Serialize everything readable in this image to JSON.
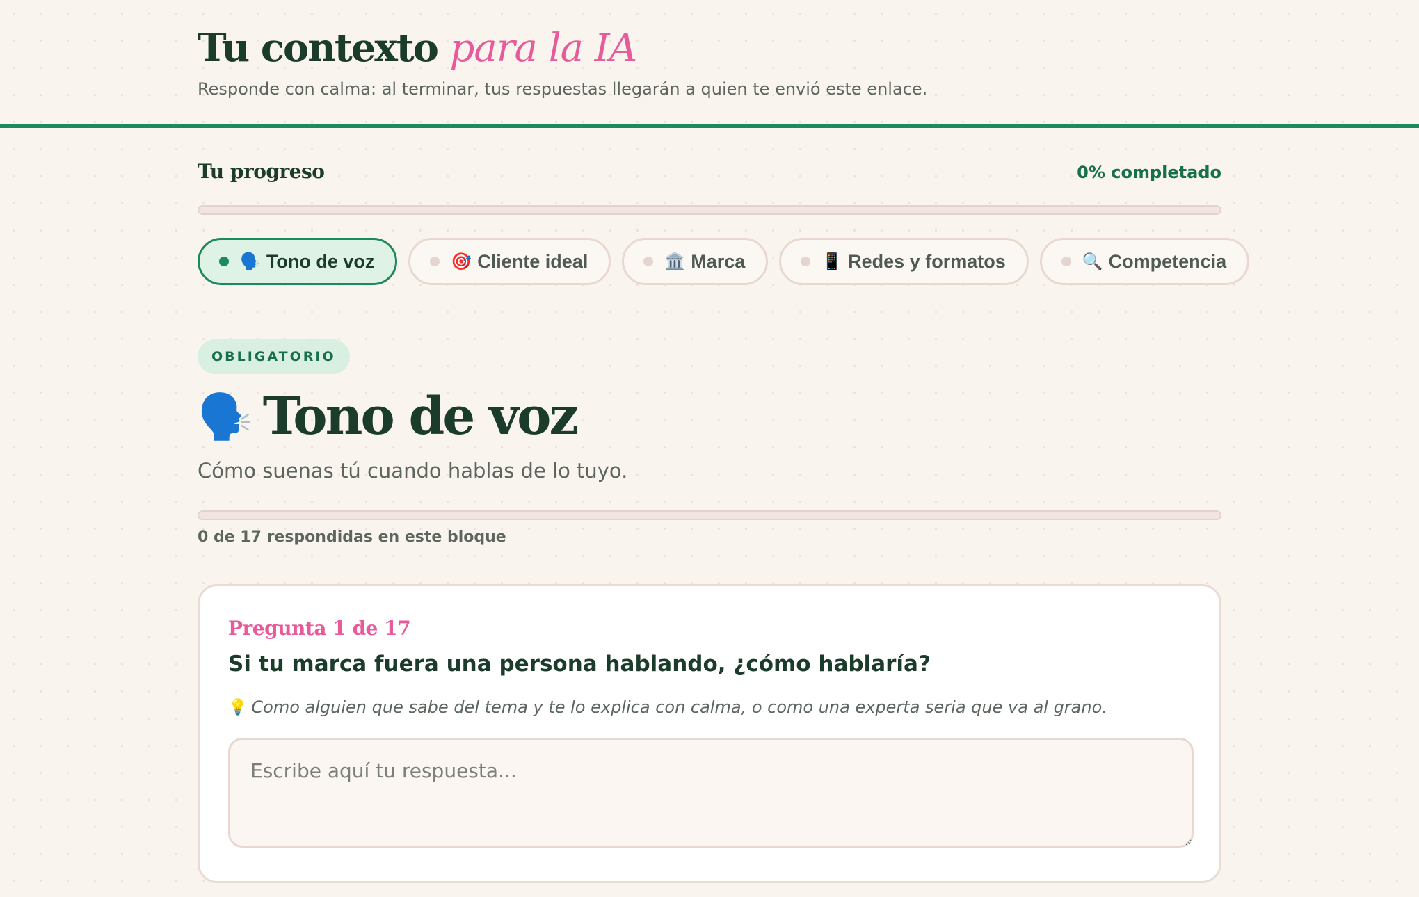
{
  "header": {
    "title_main": "Tu contexto",
    "title_accent": "para la IA",
    "subtitle": "Responde con calma: al terminar, tus respuestas llegarán a quien te envió este enlace."
  },
  "progress": {
    "title": "Tu progreso",
    "percent_label": "0% completado",
    "percent": 0
  },
  "tabs": [
    {
      "emoji": "🗣️",
      "label": "Tono de voz",
      "active": true
    },
    {
      "emoji": "🎯",
      "label": "Cliente ideal",
      "active": false
    },
    {
      "emoji": "🏛️",
      "label": "Marca",
      "active": false
    },
    {
      "emoji": "📱",
      "label": "Redes y formatos",
      "active": false
    },
    {
      "emoji": "🔍",
      "label": "Competencia",
      "active": false
    }
  ],
  "section": {
    "badge": "OBLIGATORIO",
    "emoji": "🗣️",
    "title": "Tono de voz",
    "description": "Cómo suenas tú cuando hablas de lo tuyo.",
    "answered_label": "0 de 17 respondidas en este bloque",
    "answered_fraction": 0
  },
  "question": {
    "number_label": "Pregunta 1 de 17",
    "text": "Si tu marca fuera una persona hablando, ¿cómo hablaría?",
    "hint_emoji": "💡",
    "hint": "Como alguien que sabe del tema y te lo explica con calma, o como una experta seria que va al grano.",
    "answer_value": "",
    "answer_placeholder": "Escribe aquí tu respuesta..."
  },
  "colors": {
    "background": "#f9f4ee",
    "primary_green": "#1b8a5d",
    "dark_green": "#1b3b2b",
    "accent_pink": "#e75b9b",
    "border": "#e8d8d1"
  }
}
